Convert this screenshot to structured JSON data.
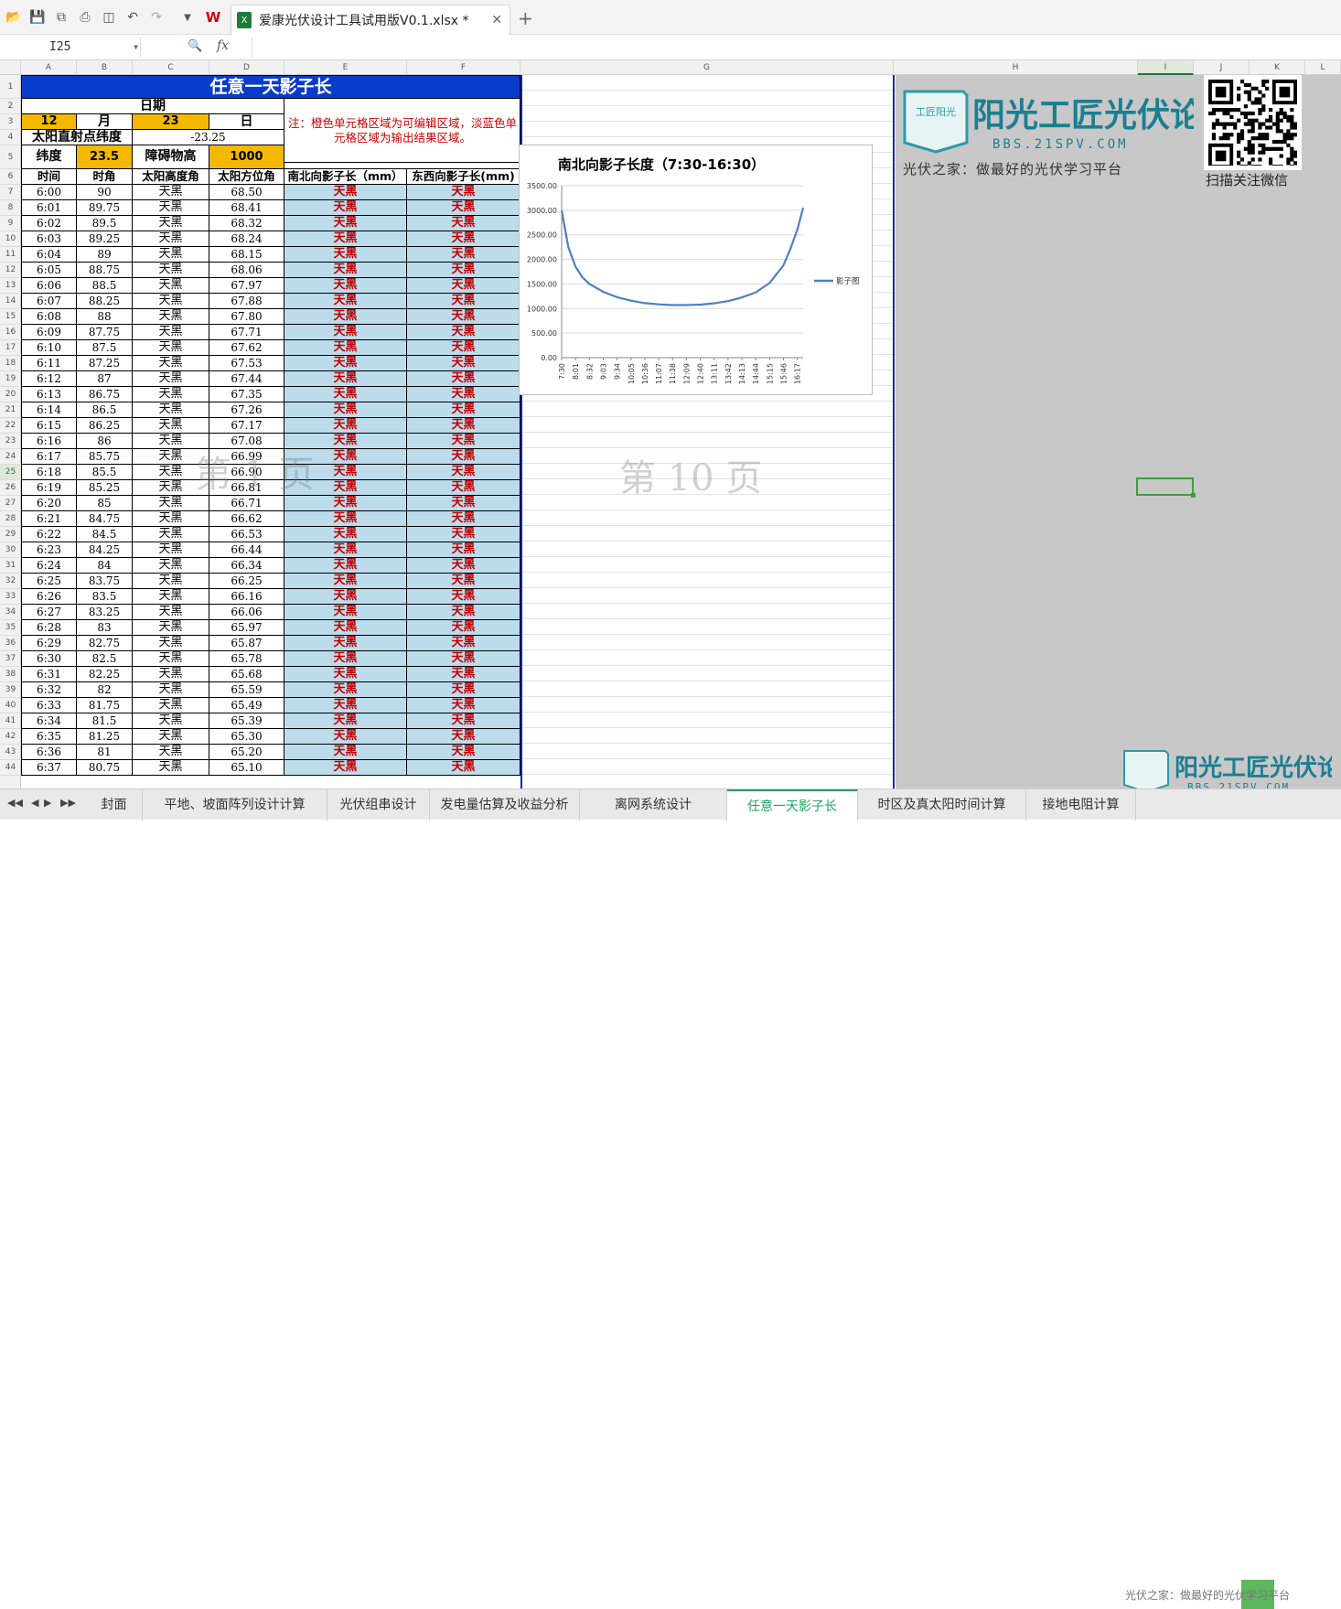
{
  "file_name": "爱康光伏设计工具试用版V0.1.xlsx *",
  "name_box": "I25",
  "fx_label": "fx",
  "columns": [
    "A",
    "B",
    "C",
    "D",
    "E",
    "F",
    "G",
    "H",
    "I",
    "J",
    "K",
    "L"
  ],
  "sheet_title": "任意一天影子长",
  "date_label": "日期",
  "month": "12",
  "month_unit": "月",
  "day": "23",
  "day_unit": "日",
  "lat_label": "太阳直射点纬度",
  "lat_value": "-23.25",
  "latitude_label": "纬度",
  "latitude_value": "23.5",
  "obstacle_label": "障碍物高",
  "obstacle_value": "1000",
  "note": "注：橙色单元格区域为可编辑区域，淡蓝色单元格区域为输出结果区域。",
  "headers": [
    "时间",
    "时角",
    "太阳高度角",
    "太阳方位角",
    "南北向影子长（mm）",
    "东西向影子长(mm)"
  ],
  "rows": [
    [
      "6:00",
      "90",
      "天黑",
      "68.50",
      "天黑",
      "天黑"
    ],
    [
      "6:01",
      "89.75",
      "天黑",
      "68.41",
      "天黑",
      "天黑"
    ],
    [
      "6:02",
      "89.5",
      "天黑",
      "68.32",
      "天黑",
      "天黑"
    ],
    [
      "6:03",
      "89.25",
      "天黑",
      "68.24",
      "天黑",
      "天黑"
    ],
    [
      "6:04",
      "89",
      "天黑",
      "68.15",
      "天黑",
      "天黑"
    ],
    [
      "6:05",
      "88.75",
      "天黑",
      "68.06",
      "天黑",
      "天黑"
    ],
    [
      "6:06",
      "88.5",
      "天黑",
      "67.97",
      "天黑",
      "天黑"
    ],
    [
      "6:07",
      "88.25",
      "天黑",
      "67.88",
      "天黑",
      "天黑"
    ],
    [
      "6:08",
      "88",
      "天黑",
      "67.80",
      "天黑",
      "天黑"
    ],
    [
      "6:09",
      "87.75",
      "天黑",
      "67.71",
      "天黑",
      "天黑"
    ],
    [
      "6:10",
      "87.5",
      "天黑",
      "67.62",
      "天黑",
      "天黑"
    ],
    [
      "6:11",
      "87.25",
      "天黑",
      "67.53",
      "天黑",
      "天黑"
    ],
    [
      "6:12",
      "87",
      "天黑",
      "67.44",
      "天黑",
      "天黑"
    ],
    [
      "6:13",
      "86.75",
      "天黑",
      "67.35",
      "天黑",
      "天黑"
    ],
    [
      "6:14",
      "86.5",
      "天黑",
      "67.26",
      "天黑",
      "天黑"
    ],
    [
      "6:15",
      "86.25",
      "天黑",
      "67.17",
      "天黑",
      "天黑"
    ],
    [
      "6:16",
      "86",
      "天黑",
      "67.08",
      "天黑",
      "天黑"
    ],
    [
      "6:17",
      "85.75",
      "天黑",
      "66.99",
      "天黑",
      "天黑"
    ],
    [
      "6:18",
      "85.5",
      "天黑",
      "66.90",
      "天黑",
      "天黑"
    ],
    [
      "6:19",
      "85.25",
      "天黑",
      "66.81",
      "天黑",
      "天黑"
    ],
    [
      "6:20",
      "85",
      "天黑",
      "66.71",
      "天黑",
      "天黑"
    ],
    [
      "6:21",
      "84.75",
      "天黑",
      "66.62",
      "天黑",
      "天黑"
    ],
    [
      "6:22",
      "84.5",
      "天黑",
      "66.53",
      "天黑",
      "天黑"
    ],
    [
      "6:23",
      "84.25",
      "天黑",
      "66.44",
      "天黑",
      "天黑"
    ],
    [
      "6:24",
      "84",
      "天黑",
      "66.34",
      "天黑",
      "天黑"
    ],
    [
      "6:25",
      "83.75",
      "天黑",
      "66.25",
      "天黑",
      "天黑"
    ],
    [
      "6:26",
      "83.5",
      "天黑",
      "66.16",
      "天黑",
      "天黑"
    ],
    [
      "6:27",
      "83.25",
      "天黑",
      "66.06",
      "天黑",
      "天黑"
    ],
    [
      "6:28",
      "83",
      "天黑",
      "65.97",
      "天黑",
      "天黑"
    ],
    [
      "6:29",
      "82.75",
      "天黑",
      "65.87",
      "天黑",
      "天黑"
    ],
    [
      "6:30",
      "82.5",
      "天黑",
      "65.78",
      "天黑",
      "天黑"
    ],
    [
      "6:31",
      "82.25",
      "天黑",
      "65.68",
      "天黑",
      "天黑"
    ],
    [
      "6:32",
      "82",
      "天黑",
      "65.59",
      "天黑",
      "天黑"
    ],
    [
      "6:33",
      "81.75",
      "天黑",
      "65.49",
      "天黑",
      "天黑"
    ],
    [
      "6:34",
      "81.5",
      "天黑",
      "65.39",
      "天黑",
      "天黑"
    ],
    [
      "6:35",
      "81.25",
      "天黑",
      "65.30",
      "天黑",
      "天黑"
    ],
    [
      "6:36",
      "81",
      "天黑",
      "65.20",
      "天黑",
      "天黑"
    ],
    [
      "6:37",
      "80.75",
      "天黑",
      "65.10",
      "天黑",
      "天黑"
    ]
  ],
  "watermark_page1": "第 1 页",
  "watermark_page10": "第 10 页",
  "chart_data": {
    "type": "line",
    "title": "南北向影子长度（7:30-16:30）",
    "x_ticks": [
      "7:30",
      "8:01",
      "8:32",
      "9:03",
      "9:34",
      "10:05",
      "10:36",
      "11:07",
      "11:38",
      "12:09",
      "12:40",
      "13:11",
      "13:42",
      "14:13",
      "14:44",
      "15:15",
      "15:46",
      "16:17"
    ],
    "y_ticks": [
      "0.00",
      "500.00",
      "1000.00",
      "1500.00",
      "2000.00",
      "2500.00",
      "3000.00",
      "3500.00"
    ],
    "ylim": [
      0,
      3500
    ],
    "legend_position": "right",
    "grid": true,
    "series": [
      {
        "name": "影子图",
        "x": [
          "7:30",
          "7:45",
          "8:01",
          "8:16",
          "8:32",
          "9:03",
          "9:34",
          "10:05",
          "10:36",
          "11:07",
          "11:38",
          "12:09",
          "12:40",
          "13:11",
          "13:42",
          "14:13",
          "14:44",
          "15:15",
          "15:46",
          "16:01",
          "16:17",
          "16:30"
        ],
        "values": [
          3000,
          2250,
          1850,
          1640,
          1500,
          1340,
          1230,
          1160,
          1110,
          1085,
          1070,
          1070,
          1080,
          1105,
          1150,
          1225,
          1330,
          1520,
          1880,
          2200,
          2600,
          3050
        ]
      }
    ]
  },
  "logo_text": "阳光工匠光伏论坛",
  "logo_badge": "工匠阳光",
  "logo_url": "BBS.21SPV.COM",
  "logo_slogan": "光伏之家：做最好的光伏学习平台",
  "qr_caption": "扫描关注微信",
  "sheet_tabs": [
    "封面",
    "平地、坡面阵列设计计算",
    "光伏组串设计",
    "发电量估算及收益分析",
    "离网系统设计",
    "任意一天影子长",
    "时区及真太阳时间计算",
    "接地电阻计算"
  ],
  "active_tab": 5,
  "bottom_watermark": "光伏之家：做最好的光伏学习平台",
  "colors": {
    "title_blue": "#0a3ccc",
    "orange": "#f5b800",
    "light_blue": "#bcdcec",
    "dark_red": "#c00000",
    "active_tab_green": "#21a366",
    "chart_line": "#4f81bd"
  }
}
